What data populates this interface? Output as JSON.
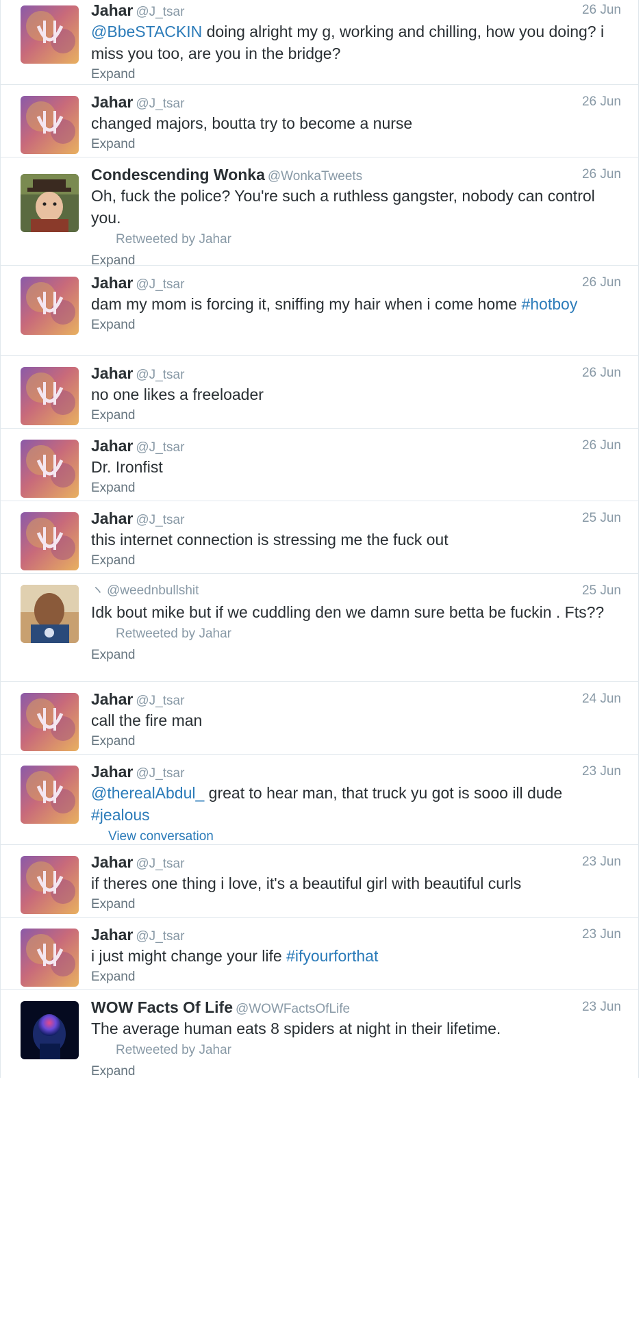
{
  "tweets": [
    {
      "name": "Jahar",
      "handle": "@J_tsar",
      "date": "26 Jun",
      "text_parts": [
        {
          "link": true,
          "text": "@BbeSTACKIN"
        },
        {
          "link": false,
          "text": " doing alright my g, working and chilling, how you doing? i miss you too, are you in the bridge?"
        }
      ],
      "expand": "Expand",
      "avatar": "jahar-avatar"
    },
    {
      "name": "Jahar",
      "handle": "@J_tsar",
      "date": "26 Jun",
      "text_parts": [
        {
          "link": false,
          "text": "changed majors, boutta try to become a nurse"
        }
      ],
      "expand": "Expand",
      "avatar": "jahar-avatar"
    },
    {
      "name": "Condescending Wonka",
      "handle": "@WonkaTweets",
      "date": "26 Jun",
      "text_parts": [
        {
          "link": false,
          "text": "Oh, fuck the police? You're such a ruthless gangster, nobody can control you."
        }
      ],
      "retweeted_by": "Retweeted by Jahar",
      "expand": "Expand",
      "avatar": "wonka-avatar"
    },
    {
      "name": "Jahar",
      "handle": "@J_tsar",
      "date": "26 Jun",
      "text_parts": [
        {
          "link": false,
          "text": "dam my mom is forcing it, sniffing my hair when i come home "
        },
        {
          "link": true,
          "text": "#hotboy"
        }
      ],
      "expand": "Expand",
      "avatar": "jahar-avatar"
    },
    {
      "name": "Jahar",
      "handle": "@J_tsar",
      "date": "26 Jun",
      "text_parts": [
        {
          "link": false,
          "text": "no one likes a freeloader"
        }
      ],
      "expand": "Expand",
      "avatar": "jahar-avatar"
    },
    {
      "name": "Jahar",
      "handle": "@J_tsar",
      "date": "26 Jun",
      "text_parts": [
        {
          "link": false,
          "text": "Dr. Ironfist"
        }
      ],
      "expand": "Expand",
      "avatar": "jahar-avatar"
    },
    {
      "name": "Jahar",
      "handle": "@J_tsar",
      "date": "25 Jun",
      "text_parts": [
        {
          "link": false,
          "text": "this internet connection is stressing me the fuck out"
        }
      ],
      "expand": "Expand",
      "avatar": "jahar-avatar"
    },
    {
      "name": "",
      "name_glyph": "ヽ",
      "handle": "@weednbullshit",
      "date": "25 Jun",
      "text_parts": [
        {
          "link": false,
          "text": "Idk bout mike but if we cuddling den we damn sure betta be fuckin . Fts??"
        }
      ],
      "retweeted_by": "Retweeted by Jahar",
      "expand": "Expand",
      "avatar": "weed-avatar"
    },
    {
      "name": "Jahar",
      "handle": "@J_tsar",
      "date": "24 Jun",
      "text_parts": [
        {
          "link": false,
          "text": "call the fire man"
        }
      ],
      "expand": "Expand",
      "avatar": "jahar-avatar"
    },
    {
      "name": "Jahar",
      "handle": "@J_tsar",
      "date": "23 Jun",
      "text_parts": [
        {
          "link": true,
          "text": "@therealAbdul_"
        },
        {
          "link": false,
          "text": " great to hear man, that truck yu got is sooo ill dude "
        },
        {
          "link": true,
          "text": "#jealous"
        }
      ],
      "view_conversation": "View conversation",
      "avatar": "jahar-avatar"
    },
    {
      "name": "Jahar",
      "handle": "@J_tsar",
      "date": "23 Jun",
      "text_parts": [
        {
          "link": false,
          "text": "if theres one thing i love, it's a beautiful girl with beautiful curls"
        }
      ],
      "expand": "Expand",
      "avatar": "jahar-avatar"
    },
    {
      "name": "Jahar",
      "handle": "@J_tsar",
      "date": "23 Jun",
      "text_parts": [
        {
          "link": false,
          "text": "i just might change your life "
        },
        {
          "link": true,
          "text": "#ifyourforthat"
        }
      ],
      "expand": "Expand",
      "avatar": "jahar-avatar"
    },
    {
      "name": "WOW Facts Of Life",
      "handle": "@WOWFactsOfLife",
      "date": "23 Jun",
      "text_parts": [
        {
          "link": false,
          "text": "The average human eats 8 spiders at night in their lifetime."
        }
      ],
      "retweeted_by": "Retweeted by Jahar",
      "expand": "Expand",
      "avatar": "brain-avatar"
    }
  ],
  "colors": {
    "link": "#2b7bb9",
    "meta": "#8899a6",
    "text": "#292f33",
    "border": "#e1e8ed"
  }
}
